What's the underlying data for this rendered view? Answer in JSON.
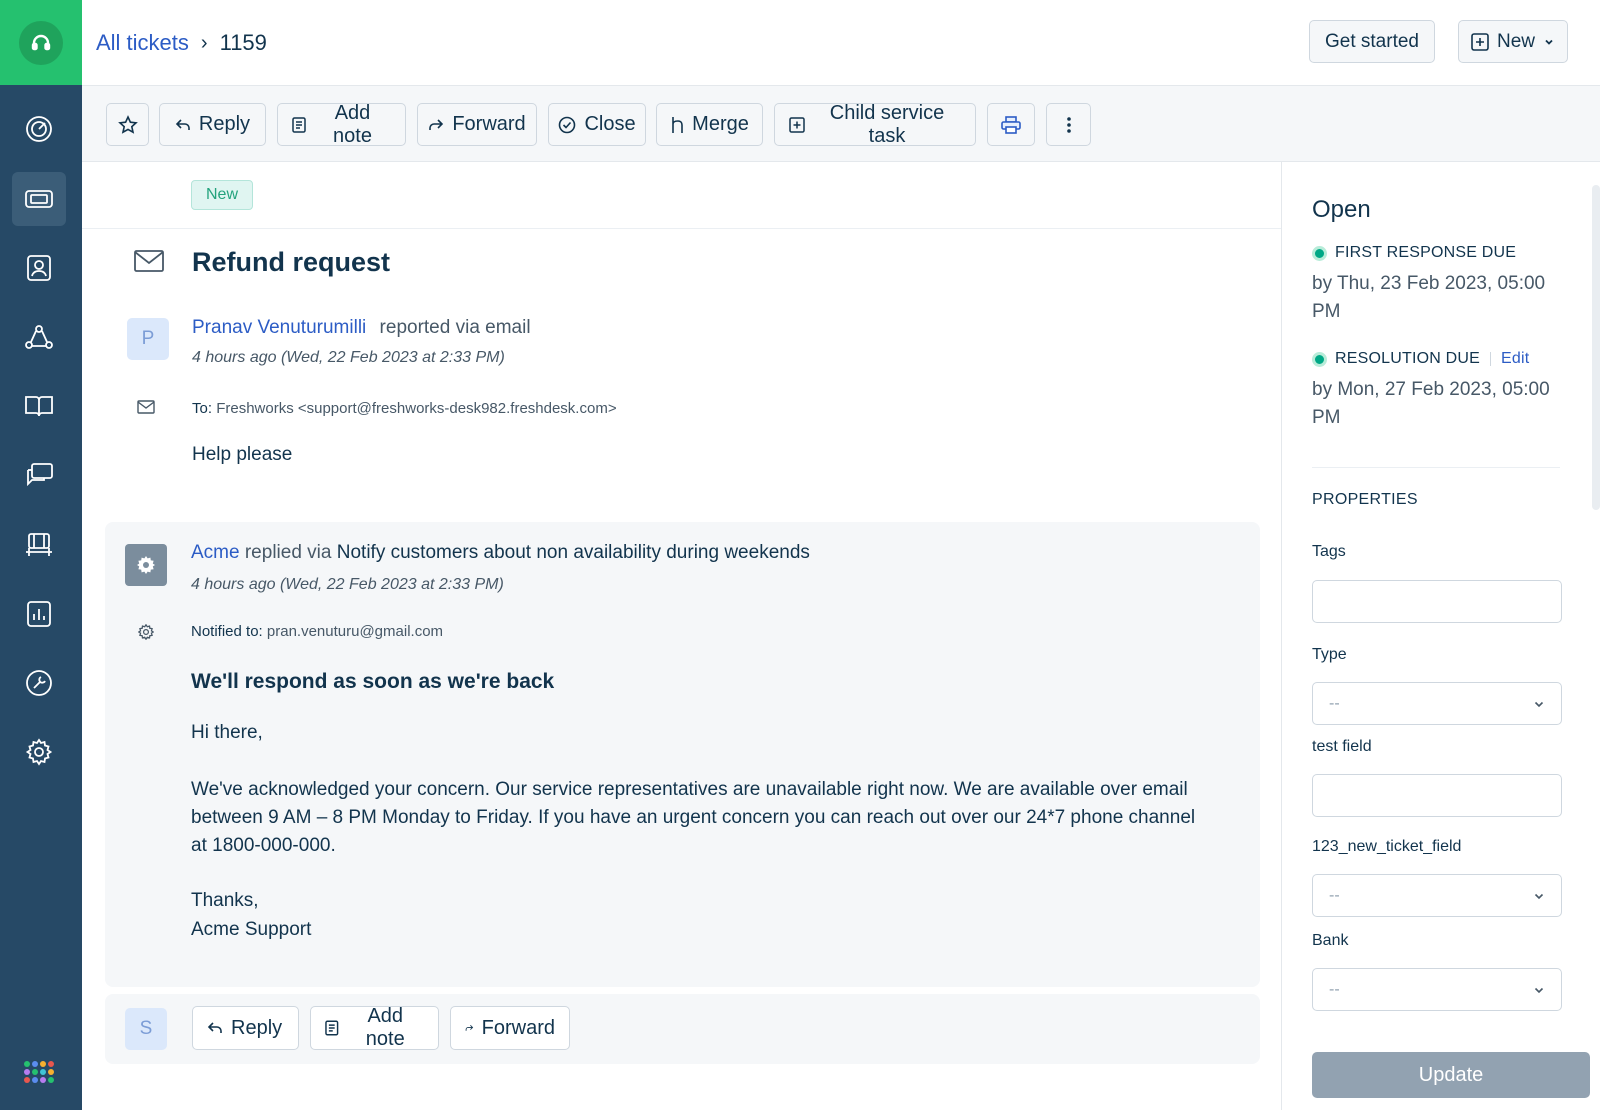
{
  "breadcrumb": {
    "all_tickets": "All tickets",
    "ticket_id": "1159"
  },
  "topbar": {
    "get_started": "Get started",
    "new": "New"
  },
  "toolbar": {
    "reply": "Reply",
    "add_note": "Add note",
    "forward": "Forward",
    "close": "Close",
    "merge": "Merge",
    "child_task": "Child service task"
  },
  "ticket": {
    "status_badge": "New",
    "subject": "Refund request",
    "requester": {
      "initial": "P",
      "name": "Pranav Venuturumilli",
      "via": "reported via email",
      "time": "4 hours ago (Wed, 22 Feb 2023 at 2:33 PM)",
      "to_label": "To:",
      "to_value": "Freshworks <support@freshworks-desk982.freshdesk.com>",
      "body": "Help please"
    },
    "reply": {
      "author": "Acme",
      "via": "replied via",
      "rule": "Notify customers about non availability during weekends",
      "time": "4 hours ago (Wed, 22 Feb 2023 at 2:33 PM)",
      "notified_label": "Notified to:",
      "notified_value": "pran.venuturu@gmail.com",
      "heading": "We'll respond as soon as we're back",
      "greeting": "Hi there,",
      "body": "We've acknowledged your concern. Our service representatives are unavailable right now. We are available over email between 9 AM – 8 PM Monday to Friday. If you have an urgent concern you can reach out over our 24*7 phone channel at 1800-000-000.",
      "signoff": "Thanks,",
      "signature": "Acme Support"
    }
  },
  "reply_bar": {
    "initial": "S",
    "reply": "Reply",
    "add_note": "Add note",
    "forward": "Forward"
  },
  "sidebar_panel": {
    "status": "Open",
    "first_response_label": "FIRST RESPONSE DUE",
    "first_response_date": "by Thu, 23 Feb 2023, 05:00 PM",
    "resolution_label": "RESOLUTION DUE",
    "resolution_edit": "Edit",
    "resolution_date": "by Mon, 27 Feb 2023, 05:00 PM",
    "properties": "PROPERTIES",
    "tags_label": "Tags",
    "type_label": "Type",
    "type_value": "--",
    "test_field_label": "test field",
    "new_ticket_field_label": "123_new_ticket_field",
    "new_ticket_field_value": "--",
    "bank_label": "Bank",
    "bank_value": "--",
    "update": "Update"
  },
  "colors": {
    "brand": "#25c16f",
    "sidebar": "#264966",
    "link": "#2c5cc5",
    "sla_ok": "#00a886"
  }
}
